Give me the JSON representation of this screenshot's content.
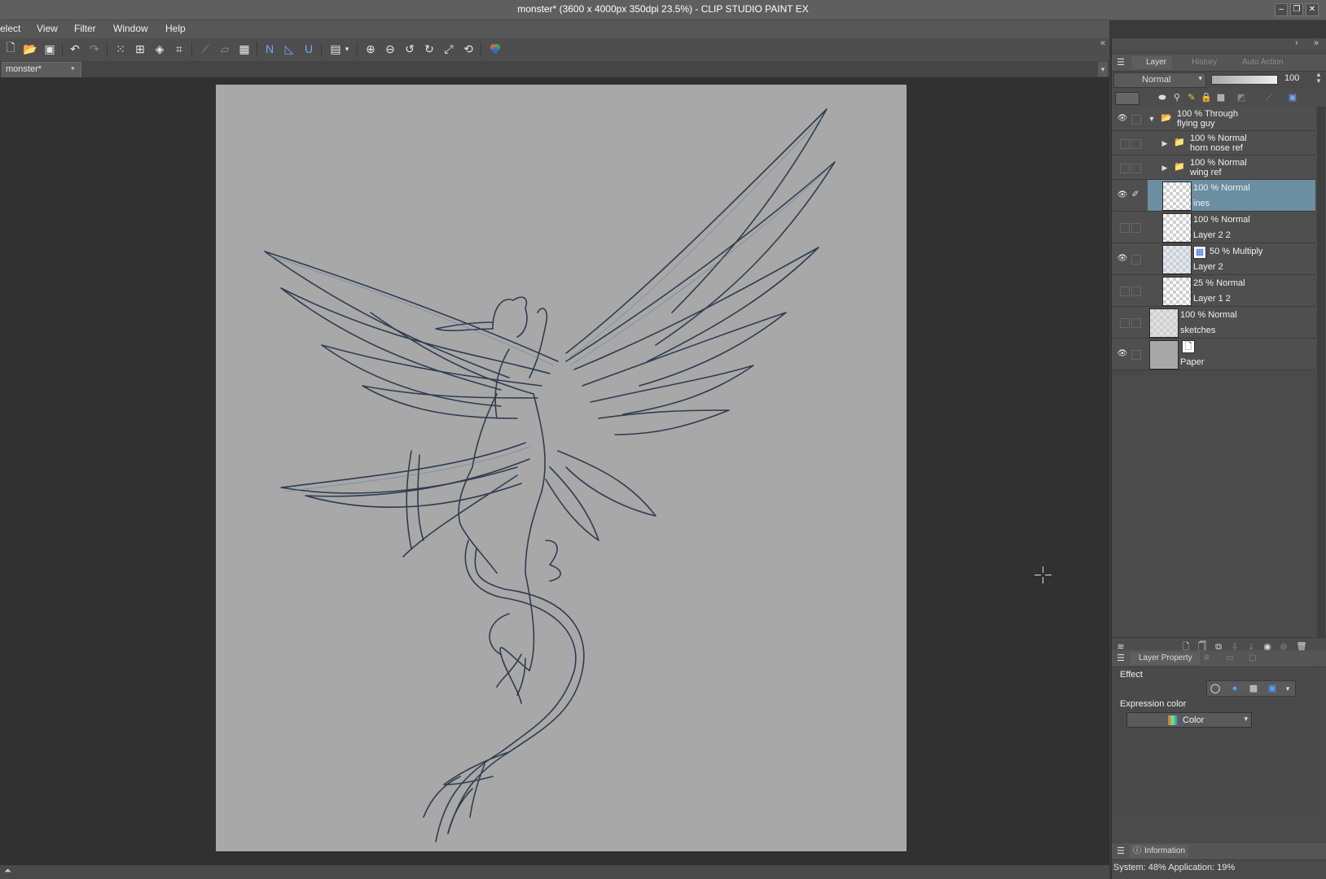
{
  "window": {
    "title": "monster* (3600 x 4000px 350dpi 23.5%)  - CLIP STUDIO PAINT EX",
    "min_icon": "minimize-icon",
    "max_icon": "maximize-icon",
    "close_icon": "close-icon"
  },
  "menu": [
    "elect",
    "View",
    "Filter",
    "Window",
    "Help"
  ],
  "document_tab": {
    "label": "monster*"
  },
  "layer_panel": {
    "tabs": [
      "Layer",
      "History",
      "Auto Action"
    ],
    "blend_mode": "Normal",
    "opacity": "100",
    "layers": [
      {
        "mode": "100 % Through",
        "name": "flying guy",
        "type": "folder",
        "visible": true,
        "expanded": true
      },
      {
        "mode": "100 % Normal",
        "name": "horn nose ref",
        "type": "folder",
        "visible": false
      },
      {
        "mode": "100 % Normal",
        "name": "wing ref",
        "type": "folder",
        "visible": false
      },
      {
        "mode": "100 % Normal",
        "name": "ines",
        "type": "raster",
        "visible": true,
        "selected": true
      },
      {
        "mode": "100 % Normal",
        "name": "Layer 2 2",
        "type": "raster",
        "visible": false
      },
      {
        "mode": "50 % Multiply",
        "name": "Layer 2",
        "type": "raster",
        "visible": true
      },
      {
        "mode": "25 % Normal",
        "name": "Layer 1 2",
        "type": "raster",
        "visible": false
      },
      {
        "mode": "100 % Normal",
        "name": "sketches",
        "type": "raster",
        "visible": false
      },
      {
        "mode": "",
        "name": "Paper",
        "type": "paper",
        "visible": true
      }
    ]
  },
  "property_panel": {
    "tab": "Layer Property",
    "effect_label": "Effect",
    "expression_color_label": "Expression color",
    "expression_color_value": "Color"
  },
  "info_panel": {
    "tab": "Information",
    "status": "System: 48% Application: 19%"
  }
}
